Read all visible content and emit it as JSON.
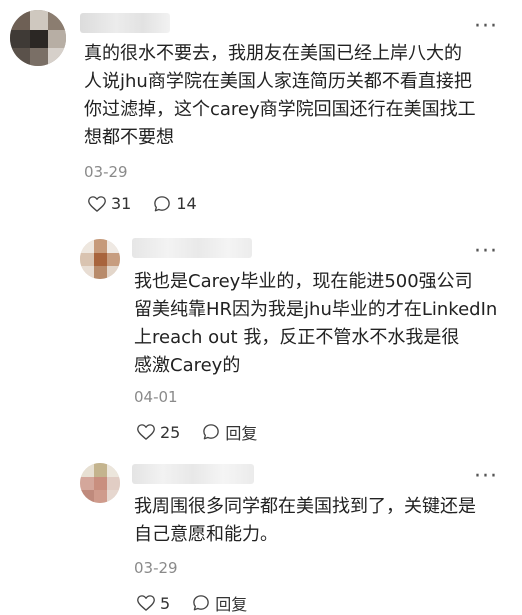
{
  "comments": [
    {
      "text_lines": [
        "真的很水不要去，我朋友在美国已经上岸八大的",
        "人说jhu商学院在美国人家连简历关都不看直接把",
        "你过滤掉，这个carey商学院回国还行在美国找工",
        "想都不要想"
      ],
      "date": "03-29",
      "likes": "31",
      "replies": "14",
      "more_icon": "more-horizontal-icon",
      "like_icon": "heart-outline-icon",
      "reply_icon": "speech-bubble-icon"
    },
    {
      "text_lines": [
        "我也是Carey毕业的，现在能进500强公司",
        "留美纯靠HR因为我是jhu毕业的才在LinkedIn",
        "上reach out 我，反正不管水不水我是很",
        "感激Carey的"
      ],
      "date": "04-01",
      "likes": "25",
      "reply_label": "回复",
      "more_icon": "more-horizontal-icon",
      "like_icon": "heart-outline-icon",
      "reply_icon": "speech-bubble-icon"
    },
    {
      "text_lines": [
        "我周围很多同学都在美国找到了，关键还是",
        "自己意愿和能力。"
      ],
      "date": "03-29",
      "likes": "5",
      "reply_label": "回复",
      "more_icon": "more-horizontal-icon",
      "like_icon": "heart-outline-icon",
      "reply_icon": "speech-bubble-icon"
    }
  ],
  "more_glyph": "···"
}
